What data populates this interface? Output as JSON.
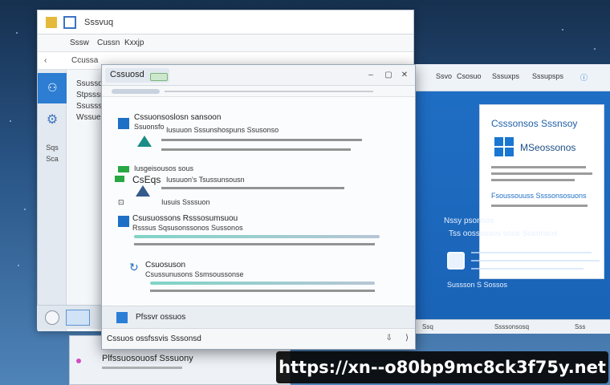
{
  "back_window": {
    "title": "Sssvuq",
    "menu": [
      "Sssw",
      "Cussn",
      "Kxxjp"
    ],
    "address": "Ccussa",
    "nav_items": [
      "Ssussd",
      "Stpsssr",
      "Ssusssn",
      "Wssuer"
    ],
    "sidebar_labels": [
      "Sqs",
      "Sca"
    ]
  },
  "front_window": {
    "title": "Cssuosd",
    "content": {
      "section1_title": "Cssuonsoslosn sansoon",
      "section1_sub": "Ssuonsfo",
      "section1_desc": "Iusuuon  Sssunshospuns Ssusonso",
      "section2_label": "Iusgeisousos sous",
      "section2_title": "CsEqs",
      "section2_desc": "Iusuuon's  Tsussunsousn",
      "section3_label": "Iusuis Ssssuon",
      "section4_title": "Csusuossons Rsssosumsuou",
      "section4_sub": "Rsssus  Sqsusonssonos Sussonos",
      "section5_title": "Csuosuson",
      "section5_sub": "Csussunusons Ssmsoussonse"
    },
    "footer_text": "Pfssvr ossuos",
    "status_text": "Cssuos ossfssvis Sssonsd",
    "status_icons": [
      "⇩",
      "⟩"
    ]
  },
  "right_window": {
    "header_items": [
      "Ssvo",
      "Csosuo",
      "Sssuxps",
      "Sssupsps"
    ],
    "card_title": "Csssonsos Sssnsoy",
    "card_logo_text": "MSeossonos",
    "card_link": "Fsoussouuss Ssssonsosuons",
    "panel_title": "Nssy psonsos",
    "panel_sub": "Tss oossossos sous Sosonsos",
    "panel_button": "Sussson S Sossos",
    "status": [
      "Ssq",
      "Ssssonsosq",
      "Sss"
    ]
  },
  "lower_window": {
    "title": "Plfssuosouosf Sssuony"
  },
  "watermark": {
    "url": "https://xn--o80bp9mc8ck3f75y.net"
  }
}
